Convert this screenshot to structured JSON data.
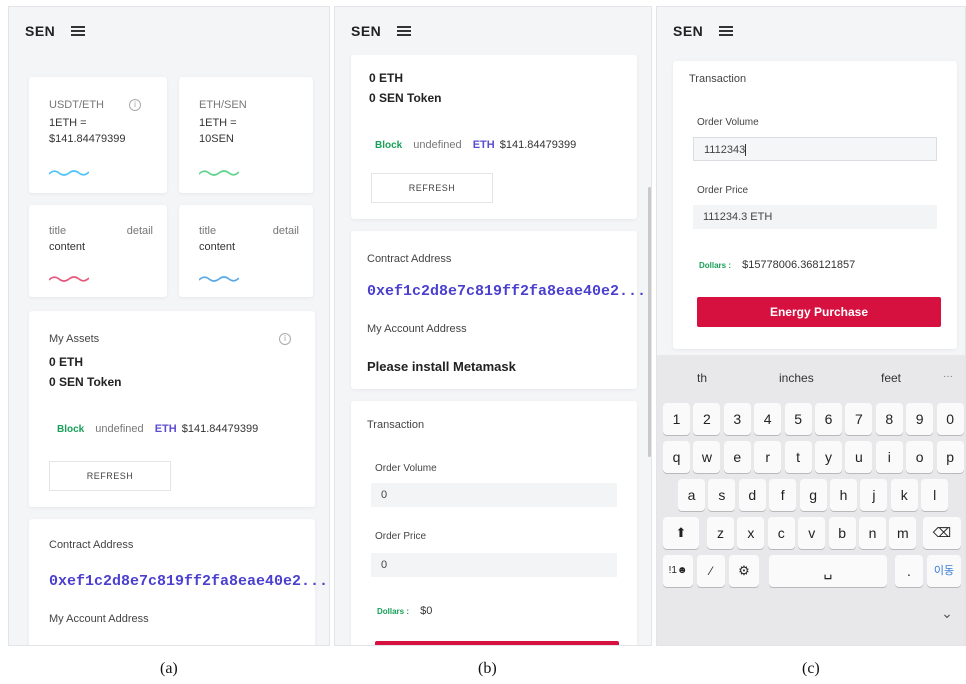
{
  "brand": "SEN",
  "colors": {
    "accent_purple": "#4a3fcf",
    "green": "#18a058",
    "purchase_red": "#d6103f",
    "bg": "#f4f5f7"
  },
  "panel_a": {
    "card_usdt": {
      "title": "USDT/ETH",
      "line1": "1ETH =",
      "line2": "$141.84479399"
    },
    "card_eth_sen": {
      "title": "ETH/SEN",
      "line1": "1ETH =",
      "line2": "10SEN"
    },
    "card_title1": {
      "title": "title",
      "detail": "detail",
      "content": "content"
    },
    "card_title2": {
      "title": "title",
      "detail": "detail",
      "content": "content"
    },
    "assets": {
      "heading": "My Assets",
      "eth": "0 ETH",
      "sen": "0 SEN Token",
      "block": "Block",
      "undefined": "undefined",
      "eth_label": "ETH",
      "eth_price": "$141.84479399",
      "refresh": "REFRESH"
    },
    "contract": {
      "heading": "Contract Address",
      "address": "0xef1c2d8e7c819ff2fa8eae40e2...",
      "account_heading": "My Account Address"
    }
  },
  "panel_b": {
    "eth": "0 ETH",
    "sen": "0 SEN Token",
    "block": "Block",
    "undefined": "undefined",
    "eth_label": "ETH",
    "eth_price": "$141.84479399",
    "refresh": "REFRESH",
    "contract_heading": "Contract Address",
    "address": "0xef1c2d8e7c819ff2fa8eae40e2...",
    "account_heading": "My Account Address",
    "metamask": "Please install Metamask",
    "transaction_heading": "Transaction",
    "order_volume_label": "Order Volume",
    "order_volume_value": "0",
    "order_price_label": "Order Price",
    "order_price_value": "0",
    "dollars_label": "Dollars :",
    "dollars_value": "$0"
  },
  "panel_c": {
    "transaction_heading": "Transaction",
    "order_volume_label": "Order Volume",
    "order_volume_value": "1112343",
    "order_price_label": "Order Price",
    "order_price_value": "111234.3 ETH",
    "dollars_label": "Dollars :",
    "dollars_value": "$15778006.368121857",
    "purchase": "Energy Purchase",
    "keyboard": {
      "suggestions": [
        "th",
        "inches",
        "feet",
        "···"
      ],
      "row1": [
        "1",
        "2",
        "3",
        "4",
        "5",
        "6",
        "7",
        "8",
        "9",
        "0"
      ],
      "row2": [
        "q",
        "w",
        "e",
        "r",
        "t",
        "y",
        "u",
        "i",
        "o",
        "p"
      ],
      "row3": [
        "a",
        "s",
        "d",
        "f",
        "g",
        "h",
        "j",
        "k",
        "l"
      ],
      "row4": [
        "z",
        "x",
        "c",
        "v",
        "b",
        "n",
        "m"
      ],
      "lang_key": "!1☻",
      "period": ".",
      "korean": "이동"
    }
  },
  "captions": {
    "a": "(a)",
    "b": "(b)",
    "c": "(c)"
  }
}
